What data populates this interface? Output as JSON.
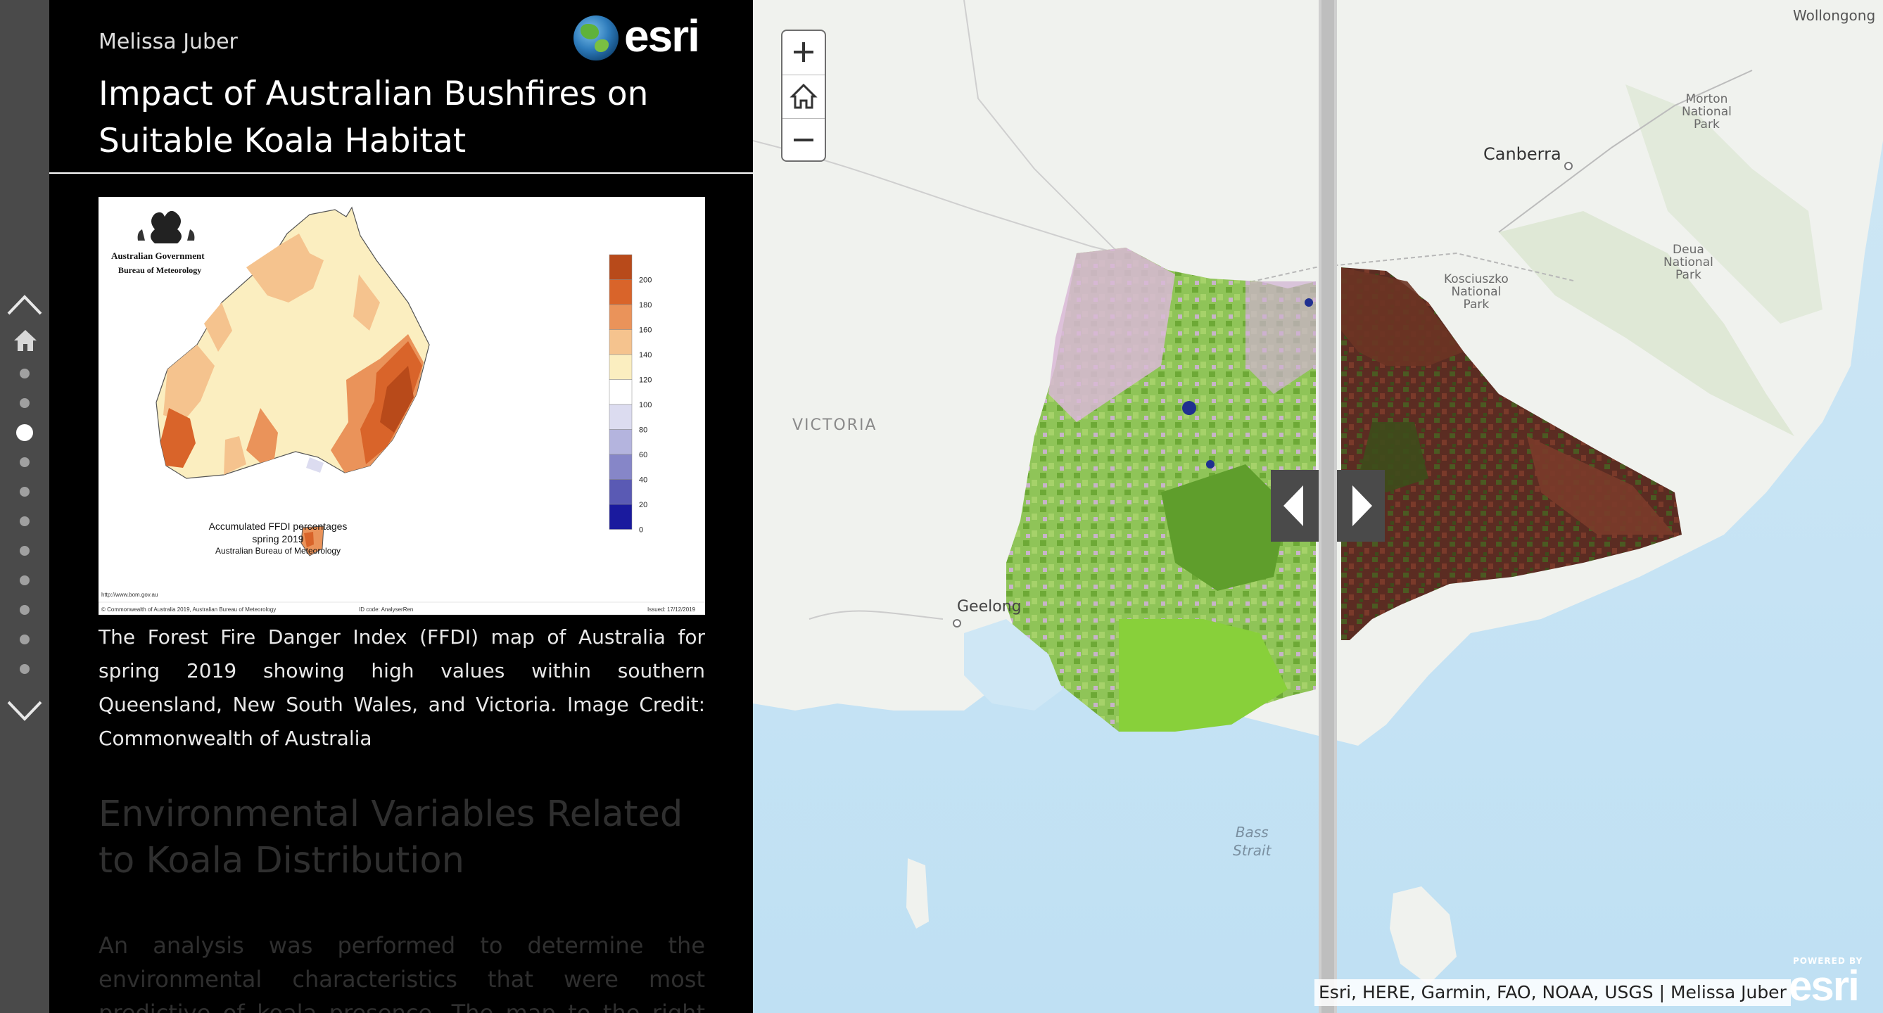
{
  "story": {
    "author": "Melissa Juber",
    "brand": "esri",
    "title": "Impact of Australian Bushfires on Suitable Koala Habitat",
    "figure": {
      "gov_line1": "Australian Government",
      "gov_line2": "Bureau of Meteorology",
      "legend_values": [
        "200",
        "180",
        "160",
        "140",
        "120",
        "100",
        "80",
        "60",
        "40",
        "20",
        "0"
      ],
      "legend_colors": [
        "#b84a1a",
        "#d9642a",
        "#ea935a",
        "#f5c38e",
        "#fbeec0",
        "#ffffff",
        "#dcdcf0",
        "#b4b4de",
        "#8686c8",
        "#5a5ab4",
        "#1a1a9e"
      ],
      "map_title": "Accumulated FFDI percentages",
      "map_subtitle": "spring 2019",
      "map_source": "Australian Bureau of Meteorology",
      "footer_url": "http://www.bom.gov.au",
      "footer_copyright": "© Commonwealth of Australia 2019, Australian Bureau of Meteorology",
      "footer_id": "ID code: AnalyserRen",
      "footer_issued": "Issued: 17/12/2019"
    },
    "caption": "The Forest Fire Danger Index (FFDI) map of Australia for spring 2019 showing high values within southern Queensland, New South Wales, and Victoria. Image Credit: Commonwealth of Australia",
    "next_heading": "Environmental Variables Related to Koala Distribution",
    "next_body": "An analysis was performed to determine the environmental characteristics that were most predictive of koala presence. The map to the right depicts the"
  },
  "nav": {
    "dots": 11,
    "active_dot": 2
  },
  "map": {
    "labels": {
      "victoria": "VICTORIA",
      "geelong": "Geelong",
      "canberra": "Canberra",
      "wollongong": "Wollongong",
      "morton": [
        "Morton",
        "National",
        "Park"
      ],
      "deua": [
        "Deua",
        "National",
        "Park"
      ],
      "kosciuszko": [
        "Kosciuszko",
        "National",
        "Park"
      ],
      "bass": [
        "Bass",
        "Strait"
      ]
    },
    "attribution": "Esri, HERE, Garmin, FAO, NOAA, USGS | Melissa Juber",
    "powered_by": "POWERED BY",
    "powered_brand": "esri"
  }
}
